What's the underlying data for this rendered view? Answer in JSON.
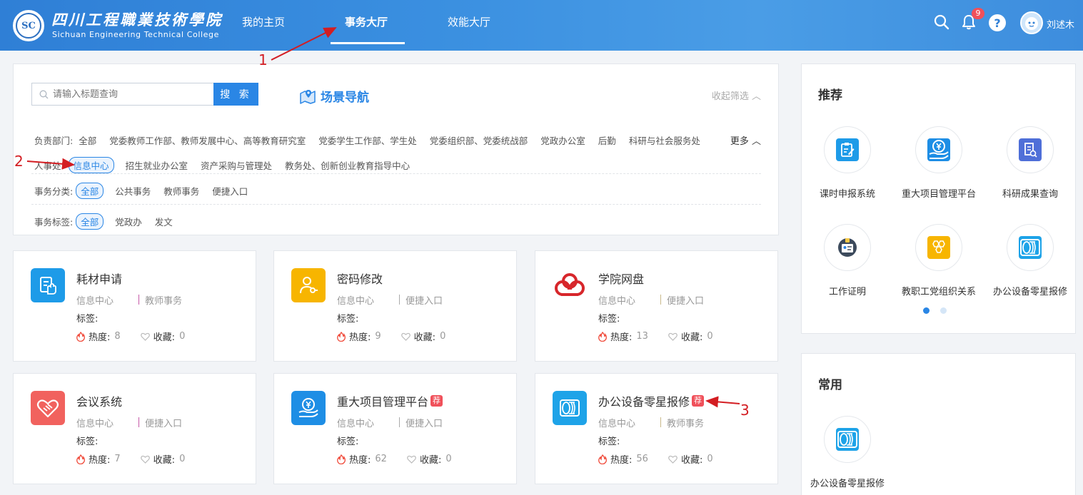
{
  "header": {
    "logo_cn": "四川工程職業技術學院",
    "logo_en": "Sichuan Engineering Technical College",
    "logo_seal": "SC",
    "nav": [
      "我的主页",
      "事务大厅",
      "效能大厅"
    ],
    "active_nav": "事务大厅",
    "notification_count": "9",
    "help": "?",
    "user_name": "刘述木"
  },
  "filter": {
    "search_placeholder": "请输入标题查询",
    "search_button": "搜 索",
    "scene_nav": "场景导航",
    "collapse": "收起筛选",
    "more": "更多",
    "dept_label": "负责部门:",
    "dept_row1": [
      "全部",
      "党委教师工作部、教师发展中心、高等教育研究室",
      "党委学生工作部、学生处",
      "党委组织部、党委统战部",
      "党政办公室",
      "后勤",
      "科研与社会服务处"
    ],
    "dept_row2": [
      "人事处",
      "信息中心",
      "招生就业办公室",
      "资产采购与管理处",
      "教务处、创新创业教育指导中心"
    ],
    "category_label": "事务分类:",
    "categories": [
      "全部",
      "公共事务",
      "教师事务",
      "便捷入口"
    ],
    "tag_label": "事务标签:",
    "tags": [
      "全部",
      "党政办",
      "发文"
    ]
  },
  "cards": [
    {
      "title": "耗材申请",
      "dept": "信息中心",
      "type": "教师事务",
      "tag_label": "标签:",
      "heat_label": "热度:",
      "heat": "8",
      "fav_label": "收藏:",
      "fav": "0",
      "recommended": false,
      "icon": "hand-doc-icon",
      "color": "#1e9be8",
      "sep_color": "#c65aa8"
    },
    {
      "title": "密码修改",
      "dept": "信息中心",
      "type": "便捷入口",
      "tag_label": "标签:",
      "heat_label": "热度:",
      "heat": "9",
      "fav_label": "收藏:",
      "fav": "0",
      "recommended": false,
      "icon": "user-key-icon",
      "color": "#f7b500",
      "sep_color": "#aaaaaa"
    },
    {
      "title": "学院网盘",
      "dept": "信息中心",
      "type": "便捷入口",
      "tag_label": "标签:",
      "heat_label": "热度:",
      "heat": "13",
      "fav_label": "收藏:",
      "fav": "0",
      "recommended": false,
      "icon": "cloud-disk-icon",
      "color": "#d7262b",
      "sep_color": "#c9b98a"
    },
    {
      "title": "会议系统",
      "dept": "信息中心",
      "type": "便捷入口",
      "tag_label": "标签:",
      "heat_label": "热度:",
      "heat": "7",
      "fav_label": "收藏:",
      "fav": "0",
      "recommended": false,
      "icon": "handshake-icon",
      "color": "#f1625e",
      "sep_color": "#c65aa8"
    },
    {
      "title": "重大项目管理平台",
      "dept": "信息中心",
      "type": "便捷入口",
      "tag_label": "标签:",
      "heat_label": "热度:",
      "heat": "62",
      "fav_label": "收藏:",
      "fav": "0",
      "recommended": true,
      "icon": "yuan-hand-icon",
      "color": "#1e8ee5",
      "sep_color": "#aaaaaa"
    },
    {
      "title": "办公设备零星报修",
      "dept": "信息中心",
      "type": "教师事务",
      "tag_label": "标签:",
      "heat_label": "热度:",
      "heat": "56",
      "fav_label": "收藏:",
      "fav": "0",
      "recommended": true,
      "icon": "coil-icon",
      "color": "#1ea3e8",
      "sep_color": "#c9b98a"
    }
  ],
  "recommend_badge": "荐",
  "recommend": {
    "title": "推荐",
    "apps": [
      {
        "name": "课时申报系统",
        "icon": "clipboard-edit-icon",
        "color": "#1e9be8"
      },
      {
        "name": "重大项目管理平台",
        "icon": "yuan-hand-icon",
        "color": "#1e8ee5"
      },
      {
        "name": "科研成果查询",
        "icon": "document-search-icon",
        "color": "#4f6fd8"
      },
      {
        "name": "工作证明",
        "icon": "id-badge-icon",
        "color": "#3c4a5c"
      },
      {
        "name": "教职工党组织关系",
        "icon": "hexagon-icon",
        "color": "#f7b500"
      },
      {
        "name": "办公设备零星报修",
        "icon": "coil-icon",
        "color": "#1ea3e8"
      }
    ],
    "page": 1,
    "pages": 2
  },
  "common": {
    "title": "常用",
    "apps": [
      {
        "name": "办公设备零星报修",
        "icon": "coil-icon",
        "color": "#1ea3e8"
      }
    ]
  },
  "annotations": [
    "1",
    "2",
    "3"
  ],
  "colors": {
    "accent": "#2a86e5",
    "header": "#3a8fe0",
    "annotation": "#d31d22",
    "badge": "#f0505a"
  }
}
